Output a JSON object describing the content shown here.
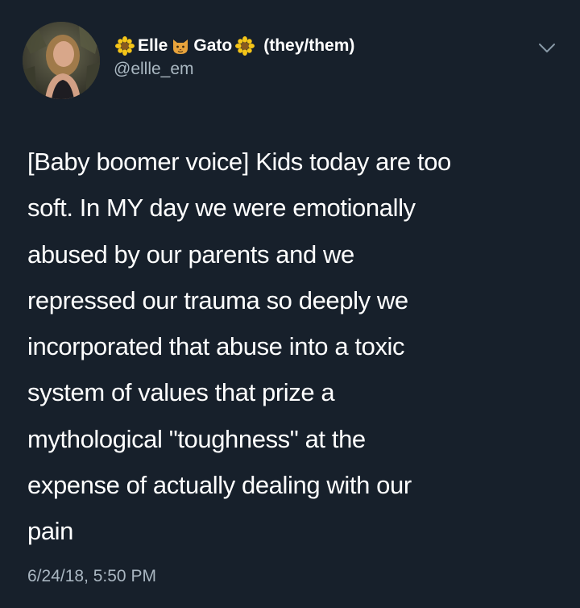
{
  "tweet": {
    "author": {
      "name_first": "Elle",
      "name_last": "Gato",
      "pronouns": "(they/them)",
      "handle": "@ellle_em",
      "emoji_prefix": "sunflower-icon",
      "emoji_middle": "cat-face-icon",
      "emoji_suffix": "sunflower-icon"
    },
    "lines": [
      "[Baby boomer voice] Kids today are too",
      "soft. In MY day we were emotionally",
      "abused by our parents and we",
      "repressed our trauma so deeply we",
      "incorporated that abuse into a toxic",
      "system of values that prize a",
      "mythological \"toughness\" at the",
      "expense of actually dealing with our",
      "pain"
    ],
    "timestamp": "6/24/18, 5:50 PM"
  },
  "colors": {
    "background": "#17202b",
    "text": "#ffffff",
    "secondary_text": "#aab8c2",
    "sunflower_petal": "#f5c518",
    "sunflower_center": "#8a5a1e",
    "cat": "#e8a33c"
  }
}
